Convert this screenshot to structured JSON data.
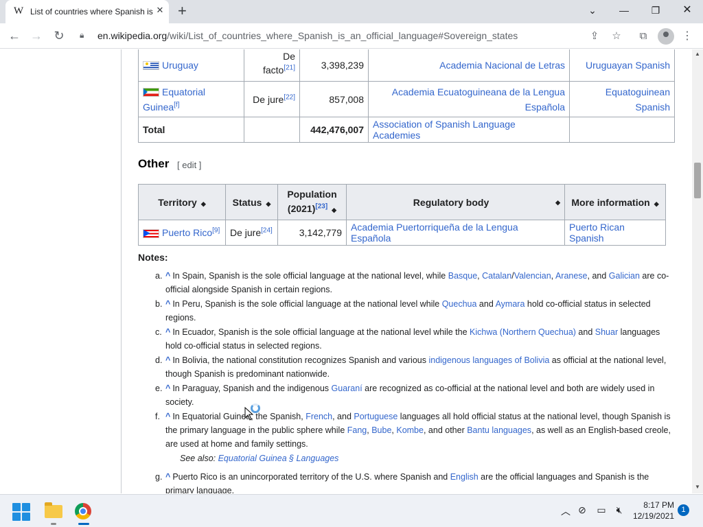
{
  "browser": {
    "tab_title": "List of countries where Spanish is an official language",
    "tab_favicon": "W",
    "url_host": "en.wikipedia.org",
    "url_path": "/wiki/List_of_countries_where_Spanish_is_an_official_language#Sovereign_states"
  },
  "sovereign_rows": [
    {
      "country": "Uruguay",
      "country_sup": "",
      "status": "De facto",
      "status_sup": "[21]",
      "population": "3,398,239",
      "regulator": "Academia Nacional de Letras",
      "info": "Uruguayan Spanish"
    },
    {
      "country": "Equatorial Guinea",
      "country_sup": "[f]",
      "status": "De jure",
      "status_sup": "[22]",
      "population": "857,008",
      "regulator": "Academia Ecuatoguineana de la Lengua Española",
      "info": "Equatoguinean Spanish"
    }
  ],
  "sovereign_total": {
    "label": "Total",
    "population": "442,476,007",
    "regulator": "Association of Spanish Language Academies"
  },
  "other": {
    "heading": "Other",
    "edit": "[ edit ]",
    "headers": {
      "territory": "Territory",
      "status": "Status",
      "population": "Population (2021)",
      "population_sup": "[23]",
      "regulator": "Regulatory body",
      "info": "More information"
    },
    "row": {
      "territory": "Puerto Rico",
      "territory_sup": "[9]",
      "status": "De jure",
      "status_sup": "[24]",
      "population": "3,142,779",
      "regulator": "Academia Puertorriqueña de la Lengua Española",
      "info": "Puerto Rican Spanish"
    }
  },
  "notes": {
    "heading": "Notes:",
    "caret": "^",
    "items": [
      {
        "letter": "a.",
        "parts": [
          "In Spain, Spanish is the sole official language at the national level, while ",
          "Basque",
          ", ",
          "Catalan",
          "/",
          "Valencian",
          ", ",
          "Aranese",
          ", and ",
          "Galician",
          " are co-official alongside Spanish in certain regions."
        ]
      },
      {
        "letter": "b.",
        "parts": [
          "In Peru, Spanish is the sole official language at the national level while ",
          "Quechua",
          " and ",
          "Aymara",
          " hold co-official status in selected regions."
        ]
      },
      {
        "letter": "c.",
        "parts": [
          "In Ecuador, Spanish is the sole official language at the national level while the ",
          "Kichwa (Northern Quechua)",
          " and ",
          "Shuar",
          " languages hold co-official status in selected regions."
        ]
      },
      {
        "letter": "d.",
        "parts": [
          "In Bolivia, the national constitution recognizes Spanish and various ",
          "indigenous languages of Bolivia",
          " as official at the national level, though Spanish is predominant nationwide."
        ]
      },
      {
        "letter": "e.",
        "parts": [
          "In Paraguay, Spanish and the indigenous ",
          "Guaraní",
          " are recognized as co-official at the national level and both are widely used in society."
        ]
      },
      {
        "letter": "f.",
        "parts": [
          "In Equatorial Guinea, the Spanish, ",
          "French",
          ", and ",
          "Portuguese",
          " languages all hold official status at the national level, though Spanish is the primary language in the public sphere while ",
          "Fang",
          ", ",
          "Bube",
          ", ",
          "Kombe",
          ", and other ",
          "Bantu languages",
          ", as well as an English-based creole, are used at home and family settings."
        ]
      },
      {
        "letter": "g.",
        "parts": [
          "Puerto Rico is an unincorporated territory of the U.S. where Spanish and ",
          "English",
          " are the official languages and Spanish is the primary language."
        ]
      }
    ],
    "see_also_prefix": "See also: ",
    "see_also_link": "Equatorial Guinea § Languages"
  },
  "taskbar": {
    "time": "8:17 PM",
    "date": "12/19/2021",
    "notification_count": "1"
  }
}
